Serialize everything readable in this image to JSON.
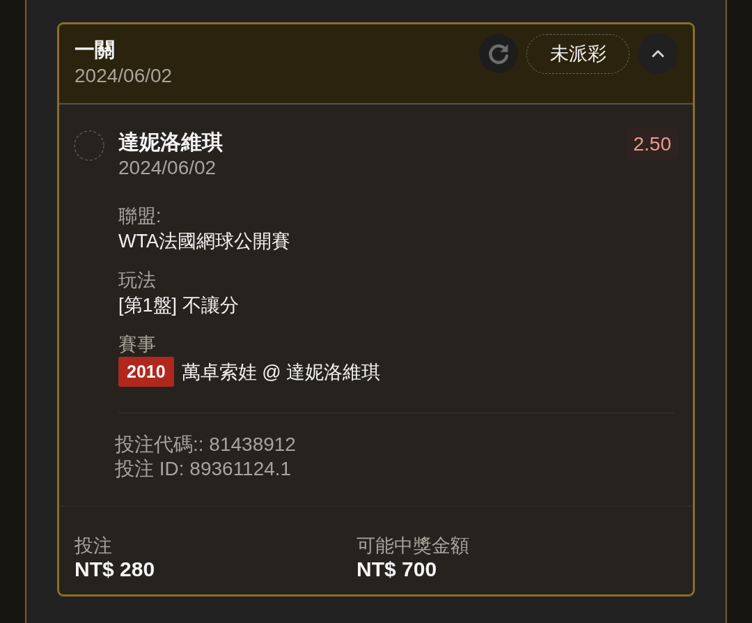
{
  "bet": {
    "title": "一關",
    "date": "2024/06/02",
    "status": "未派彩",
    "expanded": true,
    "selection": {
      "name": "達妮洛維琪",
      "date": "2024/06/02",
      "odds": "2.50",
      "details": [
        {
          "kind": "text",
          "label": "聯盟:",
          "value": "WTA法國網球公開賽"
        },
        {
          "kind": "text",
          "label": "玩法",
          "value": "[第1盤] 不讓分"
        },
        {
          "kind": "match",
          "label": "賽事",
          "badge": "2010",
          "value": "萬卓索娃 @ 達妮洛維琪"
        }
      ],
      "codes": [
        "投注代碼:: 81438912",
        "投注 ID: 89361124.1"
      ]
    },
    "summary": [
      {
        "label": "投注",
        "value": "NT$ 280"
      },
      {
        "label": "可能中獎金額",
        "value": "NT$ 700"
      }
    ]
  }
}
